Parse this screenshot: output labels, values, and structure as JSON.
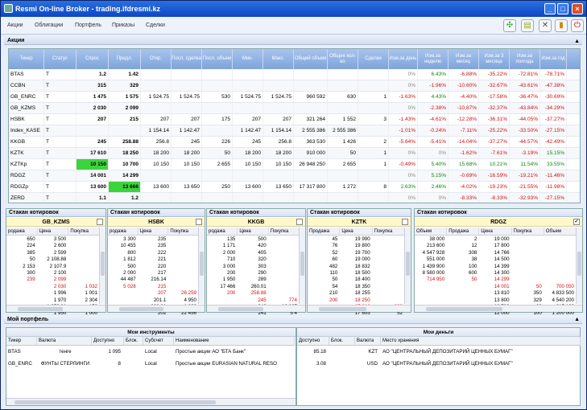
{
  "window": {
    "title": "Resmi On-line Broker - trading.ifdresmi.kz"
  },
  "menu": [
    "Акции",
    "Облигации",
    "Портфель",
    "Приказы",
    "Сделки"
  ],
  "quotes_panel": {
    "title": "Акции",
    "columns": [
      "Тикер",
      "Статус",
      "Спрос",
      "Предл.",
      "Откр.",
      "Посл. сделка",
      "Посл. объем",
      "Мин.",
      "Макс.",
      "Общий объем",
      "Общее кол-во",
      "Сделки",
      "Изм.за день",
      "Изм.за неделю",
      "Изм.за месяц",
      "Изм.за 3 месяца",
      "Изм.за полгода",
      "Изм.за год"
    ],
    "rows": [
      [
        "BTAS",
        "T",
        "1.2",
        "1.42",
        "",
        "",
        "",
        "",
        "",
        "",
        "",
        "",
        "0%",
        "6.43%",
        "-6.88%",
        "-35.22%",
        "-72.81%",
        "-78.71%"
      ],
      [
        "CCBN",
        "T",
        "315",
        "329",
        "",
        "",
        "",
        "",
        "",
        "",
        "",
        "",
        "0%",
        "-1.96%",
        "-10.60%",
        "-32.67%",
        "-43.61%",
        "-47.38%"
      ],
      [
        "GB_ENRC",
        "T",
        "1 475",
        "1 575",
        "1 524.75",
        "1 524.75",
        "530",
        "1 524.75",
        "1 524.75",
        "960 592",
        "630",
        "1",
        "-1.63%",
        "4.43%",
        "-4.40%",
        "-17.58%",
        "-36.47%",
        "-30.69%"
      ],
      [
        "GB_KZMS",
        "T",
        "2 030",
        "2 099",
        "",
        "",
        "",
        "",
        "",
        "",
        "",
        "",
        "0%",
        "-2.38%",
        "-10.87%",
        "-32.37%",
        "-43.84%",
        "-34.29%"
      ],
      [
        "HSBK",
        "T",
        "207",
        "215",
        "207",
        "207",
        "175",
        "207",
        "207",
        "321 264",
        "1 552",
        "3",
        "-1.43%",
        "-4.61%",
        "-12.28%",
        "-36.31%",
        "-44.05%",
        "-37.27%"
      ],
      [
        "Index_KASE",
        "T",
        "",
        "",
        "1 154.14",
        "1 142.47",
        "",
        "1 142.47",
        "1 154.14",
        "2 555 386",
        "2 555 386",
        "",
        "-1.01%",
        "-0.24%",
        "-7.11%",
        "-25.22%",
        "-33.50%",
        "-27.15%"
      ],
      [
        "KKGB",
        "T",
        "245",
        "258.88",
        "256.8",
        "245",
        "226",
        "245",
        "256.8",
        "363 530",
        "1 426",
        "2",
        "-5.64%",
        "-5.41%",
        "-14.04%",
        "-37.27%",
        "-44.57%",
        "-42.49%"
      ],
      [
        "KZTK",
        "T",
        "17 610",
        "18 250",
        "18 200",
        "18 200",
        "50",
        "18 200",
        "18 200",
        "910 000",
        "50",
        "1",
        "0%",
        "0%",
        "-1.62%",
        "-7.61%",
        "-3.19%",
        "15.15%"
      ],
      [
        "KZTKp",
        "T",
        "10 150",
        "10 700",
        "10 150",
        "10 150",
        "2 655",
        "10 150",
        "10 150",
        "26 948 250",
        "2 655",
        "1",
        "-0.49%",
        "5.40%",
        "15.68%",
        "10.21%",
        "11.54%",
        "33.55%"
      ],
      [
        "RDGZ",
        "T",
        "14 001",
        "14 299",
        "",
        "",
        "",
        "",
        "",
        "",
        "",
        "",
        "0%",
        "5.15%",
        "-0.69%",
        "-16.59%",
        "-19.21%",
        "-11.46%"
      ],
      [
        "RDGZp",
        "T",
        "13 600",
        "13 666",
        "13 600",
        "13 650",
        "250",
        "13 600",
        "13 650",
        "17 317 800",
        "1 272",
        "8",
        "2.63%",
        "2.46%",
        "-4.02%",
        "-19.23%",
        "-21.55%",
        "-11.98%"
      ],
      [
        "ZERD",
        "T",
        "1.1",
        "1.2",
        "",
        "",
        "",
        "",
        "",
        "",
        "",
        "",
        "0%",
        "0%",
        "-8.33%",
        "-8.33%",
        "-32.93%",
        "-27.15%"
      ]
    ]
  },
  "orderbook_label": "Стакан котировок",
  "orderbooks": [
    {
      "ticker": "GB_KZMS",
      "cols": [
        "родажа",
        "Цена",
        "Покупка"
      ],
      "rows": [
        [
          "650",
          "3 500",
          ""
        ],
        [
          "224",
          "2 600",
          ""
        ],
        [
          "385",
          "2 599",
          ""
        ],
        [
          "50",
          "2 108.88",
          ""
        ],
        [
          "2 153",
          "2 107.9",
          ""
        ],
        [
          "300",
          "2 100",
          ""
        ],
        [
          "239",
          "2 099",
          ""
        ],
        [
          "",
          "2 030",
          "1 032"
        ],
        [
          "",
          "1 996",
          "1 001"
        ],
        [
          "",
          "1 970",
          "2 304"
        ],
        [
          "",
          "1 950.01",
          "150"
        ],
        [
          "",
          "1 950",
          "1 000"
        ]
      ]
    },
    {
      "ticker": "HSBK",
      "cols": [
        "родажа",
        "Цена",
        "Покупка"
      ],
      "rows": [
        [
          "3 300",
          "235",
          ""
        ],
        [
          "10 455",
          "235",
          ""
        ],
        [
          "800",
          "222",
          ""
        ],
        [
          "1 812",
          "221",
          ""
        ],
        [
          "500",
          "220",
          ""
        ],
        [
          "2 000",
          "217",
          ""
        ],
        [
          "44 487",
          "216.14",
          ""
        ],
        [
          "5 028",
          "215",
          ""
        ],
        [
          "",
          "207",
          "26 259"
        ],
        [
          "",
          "201.1",
          "4 950"
        ],
        [
          "",
          "202.01",
          "1 800"
        ],
        [
          "",
          "202",
          "22 456"
        ]
      ]
    },
    {
      "ticker": "KKGB",
      "cols": [
        "родажа",
        "Цена",
        "Покупка"
      ],
      "rows": [
        [
          "135",
          "500",
          ""
        ],
        [
          "1 171",
          "420",
          ""
        ],
        [
          "2 000",
          "405",
          ""
        ],
        [
          "710",
          "320",
          ""
        ],
        [
          "3 000",
          "303",
          ""
        ],
        [
          "200",
          "290",
          ""
        ],
        [
          "1 950",
          "289",
          ""
        ],
        [
          "17 466",
          "260.01",
          ""
        ],
        [
          "200",
          "258.88",
          ""
        ],
        [
          "",
          "245",
          "774"
        ],
        [
          "",
          "243",
          "18 667"
        ],
        [
          "",
          "241",
          "5 4"
        ]
      ]
    },
    {
      "ticker": "KZTK",
      "cols": [
        "Продажа",
        "Цена",
        "Покупка"
      ],
      "rows": [
        [
          "45",
          "19 990",
          ""
        ],
        [
          "76",
          "19 800",
          ""
        ],
        [
          "52",
          "19 700",
          ""
        ],
        [
          "60",
          "19 000",
          ""
        ],
        [
          "482",
          "18 832",
          ""
        ],
        [
          "110",
          "18 500",
          ""
        ],
        [
          "50",
          "18 400",
          ""
        ],
        [
          "54",
          "18 350",
          ""
        ],
        [
          "210",
          "18 255",
          ""
        ],
        [
          "200",
          "18 250",
          ""
        ],
        [
          "",
          "17 610",
          "300"
        ],
        [
          "",
          "17 605",
          "52"
        ],
        [
          "",
          "17 600",
          "516"
        ]
      ]
    },
    {
      "ticker": "RDGZ",
      "cols": [
        "Объем",
        "Продажа",
        "Цена",
        "Покупка",
        "Объем"
      ],
      "rows": [
        [
          "38 000",
          "2",
          "19 000",
          "",
          ""
        ],
        [
          "213 600",
          "12",
          "17 800",
          "",
          ""
        ],
        [
          "4 547 928",
          "308",
          "14 766",
          "",
          ""
        ],
        [
          "551 000",
          "38",
          "14 500",
          "",
          ""
        ],
        [
          "1 439 900",
          "100",
          "14 399",
          "",
          ""
        ],
        [
          "8 580 000",
          "600",
          "14 300",
          "",
          ""
        ],
        [
          "714 950",
          "50",
          "14 299",
          "",
          ""
        ],
        [
          "",
          "",
          "14 001",
          "50",
          "700 050"
        ],
        [
          "",
          "",
          "13 810",
          "350",
          "4 833 500"
        ],
        [
          "",
          "",
          "13 800",
          "329",
          "4 540 200"
        ],
        [
          "",
          "",
          "13 700",
          "23",
          "315 100"
        ],
        [
          "",
          "",
          "12 000",
          "100",
          "1 200 000"
        ],
        [
          "",
          "",
          "11 900",
          "84",
          "999 600"
        ]
      ]
    }
  ],
  "portfolio": {
    "title": "Мой портфель",
    "instruments_title": "Мои инструменты",
    "instr_cols": [
      "Тикер",
      "Валюта",
      "Доступно",
      "Блок.",
      "Субсчет",
      "Наименование"
    ],
    "instr_rows": [
      [
        "BTAS",
        "тенге",
        "1 095",
        "",
        "Local",
        "Простые акции АО \"БТА Банк\""
      ],
      [
        "GB_ENRC",
        "ФУНТЫ СТЕРЛИНГИ",
        "8",
        "",
        "Local",
        "Простые акции EURASIAN NATURAL RESO"
      ]
    ],
    "money_title": "Мои деньги",
    "money_cols": [
      "Доступно",
      "Блок.",
      "Валюта",
      "Место хранения"
    ],
    "money_rows": [
      [
        "85.18",
        "",
        "KZT",
        "АО \"ЦЕНТРАЛЬНЫЙ ДЕПОЗИТАРИЙ ЦЕННЫХ БУМАГ\""
      ],
      [
        "3.08",
        "",
        "USD",
        "АО \"ЦЕНТРАЛЬНЫЙ ДЕПОЗИТАРИЙ ЦЕННЫХ БУМАГ\""
      ]
    ]
  }
}
